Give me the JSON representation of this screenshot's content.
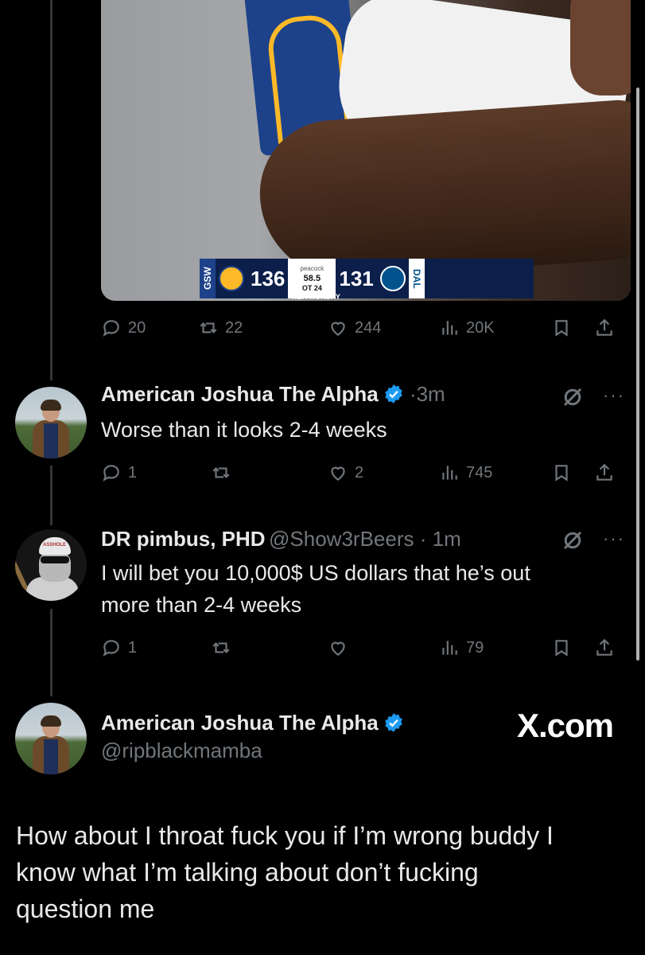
{
  "media": {
    "scorebug": {
      "home_abbr": "GSW",
      "home_score": "136",
      "network": "peacock",
      "clock": "58.5",
      "period": "OT",
      "shot_clock": "24",
      "show": "NBA MONDAY",
      "away_score": "131",
      "away_abbr": "DAL"
    }
  },
  "first_actions": {
    "replies": "20",
    "reposts": "22",
    "likes": "244",
    "views": "20K"
  },
  "tweets": [
    {
      "name": "American Joshua The Alpha",
      "handle": "",
      "time": "3m",
      "text": "Worse than it looks 2-4 weeks",
      "replies": "1",
      "reposts": "",
      "likes": "2",
      "views": "745",
      "verified": true
    },
    {
      "name": "DR pimbus, PHD",
      "handle": "@Show3rBeers",
      "time": "1m",
      "text_line1": "I will bet you 10,000$ US dollars that he’s out",
      "text_line2": "more than 2-4 weeks",
      "replies": "1",
      "reposts": "",
      "likes": "",
      "views": "79",
      "avatar_cap_text": "ASSHOLE"
    }
  ],
  "main_tweet": {
    "name": "American Joshua The Alpha",
    "handle": "@ripblackmamba",
    "watermark": "X.com",
    "text_line1": "How about I throat fuck you if I’m wrong buddy I",
    "text_line2": "know what I’m talking about don’t fucking",
    "text_line3": "question me"
  },
  "colors": {
    "background": "#000000",
    "text": "#e7e9ea",
    "muted": "#71767b",
    "verified": "#1d9bf0"
  }
}
